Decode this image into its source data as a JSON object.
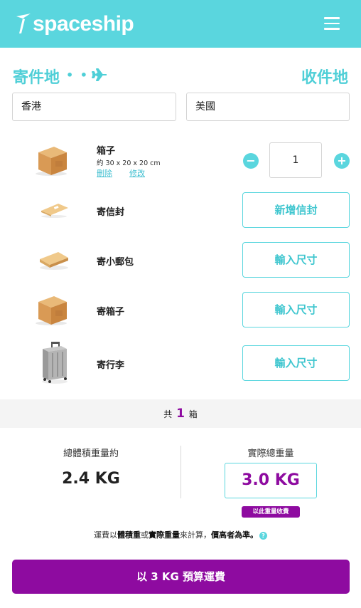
{
  "header": {
    "logo_text": "spaceship",
    "menu_icon": "hamburger-menu-icon",
    "bg_color": "#5ad6de"
  },
  "route": {
    "from_label": "寄件地",
    "to_label": "收件地",
    "dots": "• • •",
    "plane_icon": "plane-icon",
    "from_value": "香港",
    "to_value": "美國"
  },
  "item_box": {
    "title": "箱子",
    "dimensions": "約 30 x 20 x 20 cm",
    "delete_label": "刪除",
    "edit_label": "修改",
    "minus": "−",
    "plus": "+",
    "quantity": "1"
  },
  "options": [
    {
      "title": "寄信封",
      "button": "新增信封",
      "icon": "envelope-icon"
    },
    {
      "title": "寄小郵包",
      "button": "輸入尺寸",
      "icon": "small-parcel-icon"
    },
    {
      "title": "寄箱子",
      "button": "輸入尺寸",
      "icon": "box-icon"
    },
    {
      "title": "寄行李",
      "button": "輸入尺寸",
      "icon": "suitcase-icon"
    }
  ],
  "total": {
    "prefix": "共",
    "count": "1",
    "unit": "箱"
  },
  "weights": {
    "volumetric_label": "總體積重量約",
    "volumetric_value": "2.4 KG",
    "actual_label": "實際總重量",
    "actual_value": "3.0 KG",
    "badge": "以此重量收費"
  },
  "note": {
    "p1": "運費以",
    "b1": "體積重",
    "p2": "或",
    "b2": "實際重量",
    "p3": "來計算，",
    "b3": "價高者為準。",
    "help": "?"
  },
  "cta": {
    "label": "以 3 KG 預算運費"
  },
  "colors": {
    "accent": "#5ad6de",
    "primary": "#8e0ba0"
  }
}
